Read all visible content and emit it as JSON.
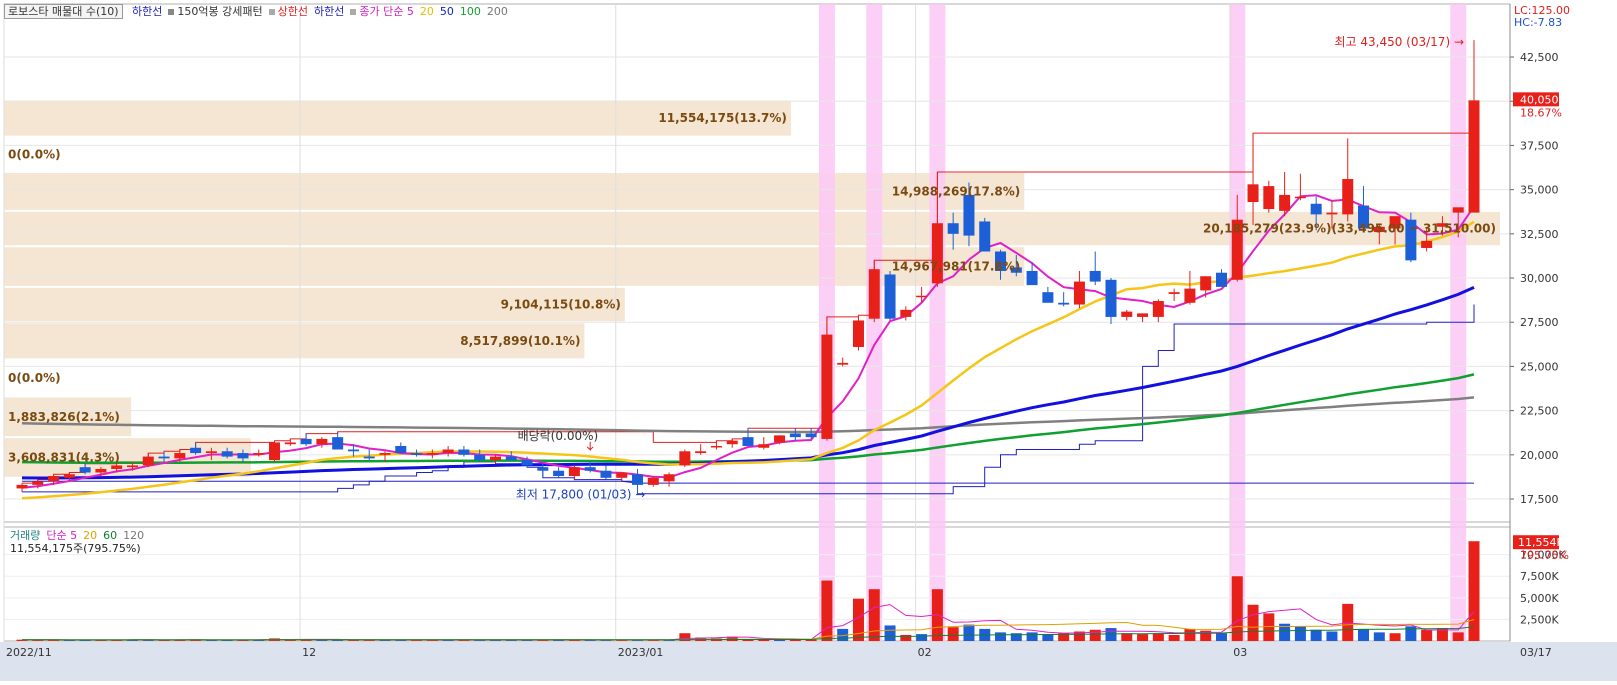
{
  "legend_top": {
    "box_label": "로보스타 매물대 수(10)",
    "items": [
      {
        "text": "하한선",
        "color": "#2020c0"
      },
      {
        "text": "150억봉 강세패턴",
        "color": "#333333",
        "square": "#888888"
      },
      {
        "text": "상한선",
        "color": "#e02020",
        "square": "#aaaaaa"
      },
      {
        "text": "하한선",
        "color": "#2020c0"
      },
      {
        "text": "종가 단순 5",
        "color": "#d020c0",
        "square": "#aaaaaa"
      },
      {
        "text": "20",
        "color": "#e0c000"
      },
      {
        "text": "50",
        "color": "#1020d0"
      },
      {
        "text": "100",
        "color": "#10a030"
      },
      {
        "text": "200",
        "color": "#777777"
      }
    ]
  },
  "legend_vol": {
    "items": [
      {
        "text": "거래량",
        "color": "#208080"
      },
      {
        "text": "단순 5",
        "color": "#d020c0"
      },
      {
        "text": "20",
        "color": "#e0a000"
      },
      {
        "text": "60",
        "color": "#108030"
      },
      {
        "text": "120",
        "color": "#777777"
      }
    ],
    "value_line": "11,554,175주(795.75%)"
  },
  "corner_labels": {
    "lc": "LC:125.00",
    "hc": "HC:-7.83"
  },
  "price_tag": {
    "value": "40,050",
    "pct": "18.67%"
  },
  "vol_tag": {
    "value": "11,554K",
    "pct": "795.75%"
  },
  "annotations": {
    "high": "최고 43,450 (03/17) →",
    "low": "최저 17,800 (01/03) →",
    "dividend": "배당락(0.00%)"
  },
  "colors": {
    "up": "#e8201a",
    "down": "#1c5fd6",
    "zone": "#f5e6d3",
    "highlight": "#fbc8f5",
    "ma5": "#e020c8",
    "ma20": "#f5c518",
    "ma50": "#1010e0",
    "ma100": "#10a030",
    "ma200": "#808080"
  },
  "chart_data": {
    "type": "candlestick",
    "price_axis": {
      "ticks": [
        17500,
        20000,
        22500,
        25000,
        27500,
        30000,
        32500,
        35000,
        37500,
        40000,
        42500
      ],
      "tick_labels": [
        "17,500",
        "20,000",
        "22,500",
        "25,000",
        "27,500",
        "30,000",
        "32,500",
        "35,000",
        "37,500",
        "40,000",
        "42,500"
      ],
      "ylim": [
        16200,
        45500
      ]
    },
    "volume_axis": {
      "ticks": [
        2500,
        5000,
        7500,
        10000
      ],
      "tick_labels": [
        "2,500K",
        "5,000K",
        "7,500K",
        "10,000K"
      ],
      "ylim": [
        0,
        13200
      ]
    },
    "x_labels": [
      {
        "label": "2022/11",
        "bar": 0
      },
      {
        "label": "12",
        "bar": 18
      },
      {
        "label": "2023/01",
        "bar": 38
      },
      {
        "label": "02",
        "bar": 57
      },
      {
        "label": "03",
        "bar": 77
      },
      {
        "label": "03/17",
        "bar": 88
      }
    ],
    "candles": [
      [
        18100,
        18400,
        17900,
        18300
      ],
      [
        18300,
        18600,
        18100,
        18500
      ],
      [
        18500,
        18900,
        18300,
        18800
      ],
      [
        18700,
        19000,
        18500,
        18900
      ],
      [
        19300,
        19500,
        18900,
        19000
      ],
      [
        19000,
        19300,
        18800,
        19200
      ],
      [
        19200,
        19600,
        19000,
        19400
      ],
      [
        19300,
        19600,
        19100,
        19400
      ],
      [
        19400,
        20100,
        19300,
        19900
      ],
      [
        19900,
        20200,
        19600,
        19800
      ],
      [
        19800,
        20300,
        19600,
        20100
      ],
      [
        20400,
        20700,
        20000,
        20100
      ],
      [
        20100,
        20400,
        19700,
        20200
      ],
      [
        20200,
        20400,
        19800,
        19900
      ],
      [
        20100,
        20300,
        19600,
        19800
      ],
      [
        20000,
        20300,
        19900,
        20100
      ],
      [
        19700,
        20800,
        19600,
        20700
      ],
      [
        20600,
        20900,
        20500,
        20700
      ],
      [
        20900,
        21200,
        20500,
        20600
      ],
      [
        20600,
        21000,
        20400,
        20900
      ],
      [
        21000,
        21300,
        20600,
        20300
      ],
      [
        20300,
        20600,
        19900,
        20200
      ],
      [
        19900,
        20300,
        19700,
        19800
      ],
      [
        20000,
        20200,
        19600,
        20100
      ],
      [
        20500,
        20700,
        20100,
        20100
      ],
      [
        20100,
        20300,
        19900,
        20000
      ],
      [
        20000,
        20300,
        19800,
        20100
      ],
      [
        20100,
        20500,
        19900,
        20300
      ],
      [
        20300,
        20500,
        19900,
        20000
      ],
      [
        20000,
        20300,
        19600,
        19700
      ],
      [
        19700,
        20000,
        19500,
        19900
      ],
      [
        19900,
        20200,
        19700,
        19700
      ],
      [
        19700,
        19900,
        19300,
        19400
      ],
      [
        19300,
        19500,
        18700,
        19100
      ],
      [
        19100,
        19300,
        18700,
        18800
      ],
      [
        18800,
        19400,
        18600,
        19300
      ],
      [
        19300,
        19600,
        19000,
        19100
      ],
      [
        19100,
        19400,
        18600,
        18700
      ],
      [
        18700,
        19000,
        18500,
        19000
      ],
      [
        18900,
        19200,
        17800,
        18300
      ],
      [
        18300,
        18800,
        18200,
        18700
      ],
      [
        18500,
        19000,
        18200,
        18900
      ],
      [
        19400,
        20300,
        19300,
        20200
      ],
      [
        20100,
        20600,
        20000,
        20200
      ],
      [
        20500,
        20800,
        20300,
        20500
      ],
      [
        20600,
        20900,
        20400,
        20800
      ],
      [
        21000,
        21500,
        20900,
        20500
      ],
      [
        20400,
        21000,
        20300,
        20600
      ],
      [
        20700,
        21100,
        20600,
        21100
      ],
      [
        21200,
        21500,
        20800,
        21000
      ],
      [
        21200,
        21500,
        20900,
        21000
      ],
      [
        20900,
        27800,
        20800,
        26800
      ],
      [
        25100,
        25500,
        25000,
        25200
      ],
      [
        26100,
        27900,
        25900,
        27600
      ],
      [
        27700,
        31000,
        27500,
        30500
      ],
      [
        30200,
        30400,
        27600,
        27700
      ],
      [
        27800,
        28400,
        27600,
        28200
      ],
      [
        29000,
        29500,
        28600,
        29000
      ],
      [
        29700,
        36000,
        29500,
        33100
      ],
      [
        33100,
        33700,
        31600,
        32500
      ],
      [
        34700,
        35400,
        31800,
        32400
      ],
      [
        33200,
        33400,
        31500,
        31500
      ],
      [
        31500,
        31600,
        29900,
        30400
      ],
      [
        30600,
        31300,
        30100,
        30300
      ],
      [
        30400,
        30900,
        29900,
        29600
      ],
      [
        29200,
        29500,
        28800,
        28600
      ],
      [
        28600,
        29200,
        28400,
        28500
      ],
      [
        28500,
        30400,
        28300,
        29800
      ],
      [
        30400,
        31500,
        29600,
        29800
      ],
      [
        29900,
        30000,
        27400,
        27800
      ],
      [
        27800,
        28200,
        27600,
        28100
      ],
      [
        27800,
        28000,
        27500,
        28000
      ],
      [
        27800,
        28800,
        27500,
        28700
      ],
      [
        29100,
        29400,
        28700,
        29200
      ],
      [
        28600,
        30400,
        28500,
        29400
      ],
      [
        29300,
        30100,
        28900,
        30100
      ],
      [
        30300,
        30500,
        29500,
        29500
      ],
      [
        29900,
        34700,
        29800,
        33300
      ],
      [
        34300,
        38200,
        33000,
        35300
      ],
      [
        33900,
        35500,
        33700,
        35200
      ],
      [
        33800,
        36000,
        33500,
        34700
      ],
      [
        34600,
        35900,
        34400,
        34600
      ],
      [
        34200,
        34600,
        32700,
        33600
      ],
      [
        33600,
        34400,
        32800,
        33700
      ],
      [
        33600,
        37900,
        33200,
        35600
      ],
      [
        34100,
        35200,
        32700,
        32800
      ],
      [
        32600,
        33000,
        31900,
        32900
      ],
      [
        32800,
        33300,
        31900,
        33500
      ],
      [
        33300,
        33700,
        30900,
        31000
      ],
      [
        31700,
        32800,
        31500,
        32100
      ],
      [
        32900,
        33500,
        32400,
        33100
      ],
      [
        33700,
        33800,
        32300,
        34000
      ],
      [
        33700,
        43450,
        36300,
        40050
      ]
    ],
    "volumes": [
      [
        150,
        "up"
      ],
      [
        120,
        "up"
      ],
      [
        150,
        "up"
      ],
      [
        110,
        "down"
      ],
      [
        130,
        "down"
      ],
      [
        120,
        "up"
      ],
      [
        150,
        "up"
      ],
      [
        140,
        "down"
      ],
      [
        130,
        "down"
      ],
      [
        120,
        "up"
      ],
      [
        130,
        "up"
      ],
      [
        160,
        "up"
      ],
      [
        120,
        "down"
      ],
      [
        130,
        "down"
      ],
      [
        120,
        "up"
      ],
      [
        140,
        "down"
      ],
      [
        300,
        "up"
      ],
      [
        180,
        "up"
      ],
      [
        160,
        "up"
      ],
      [
        150,
        "down"
      ],
      [
        130,
        "down"
      ],
      [
        150,
        "up"
      ],
      [
        110,
        "up"
      ],
      [
        120,
        "down"
      ],
      [
        150,
        "down"
      ],
      [
        130,
        "up"
      ],
      [
        140,
        "up"
      ],
      [
        120,
        "down"
      ],
      [
        130,
        "up"
      ],
      [
        120,
        "down"
      ],
      [
        150,
        "down"
      ],
      [
        110,
        "down"
      ],
      [
        130,
        "down"
      ],
      [
        150,
        "up"
      ],
      [
        130,
        "down"
      ],
      [
        120,
        "up"
      ],
      [
        130,
        "down"
      ],
      [
        120,
        "down"
      ],
      [
        140,
        "up"
      ],
      [
        150,
        "down"
      ],
      [
        120,
        "up"
      ],
      [
        130,
        "down"
      ],
      [
        900,
        "up"
      ],
      [
        400,
        "up"
      ],
      [
        300,
        "up"
      ],
      [
        500,
        "up"
      ],
      [
        180,
        "up"
      ],
      [
        150,
        "up"
      ],
      [
        200,
        "down"
      ],
      [
        180,
        "up"
      ],
      [
        150,
        "up"
      ],
      [
        7000,
        "up"
      ],
      [
        1400,
        "down"
      ],
      [
        4900,
        "up"
      ],
      [
        6000,
        "up"
      ],
      [
        1800,
        "down"
      ],
      [
        700,
        "up"
      ],
      [
        800,
        "down"
      ],
      [
        6000,
        "up"
      ],
      [
        1600,
        "up"
      ],
      [
        1900,
        "down"
      ],
      [
        1400,
        "down"
      ],
      [
        1000,
        "down"
      ],
      [
        900,
        "down"
      ],
      [
        1000,
        "down"
      ],
      [
        800,
        "down"
      ],
      [
        900,
        "up"
      ],
      [
        1100,
        "up"
      ],
      [
        1300,
        "up"
      ],
      [
        1500,
        "down"
      ],
      [
        900,
        "up"
      ],
      [
        800,
        "up"
      ],
      [
        900,
        "up"
      ],
      [
        700,
        "up"
      ],
      [
        1400,
        "up"
      ],
      [
        1200,
        "up"
      ],
      [
        900,
        "down"
      ],
      [
        7500,
        "up"
      ],
      [
        4200,
        "up"
      ],
      [
        3200,
        "up"
      ],
      [
        2000,
        "down"
      ],
      [
        1700,
        "down"
      ],
      [
        1300,
        "down"
      ],
      [
        1100,
        "down"
      ],
      [
        4300,
        "up"
      ],
      [
        1400,
        "down"
      ],
      [
        1000,
        "down"
      ],
      [
        900,
        "up"
      ],
      [
        1700,
        "down"
      ],
      [
        1300,
        "up"
      ],
      [
        1500,
        "up"
      ],
      [
        1000,
        "up"
      ],
      [
        11554,
        "up"
      ]
    ],
    "highlight_bars": [
      51,
      54,
      58,
      77,
      91
    ],
    "volume_profile": [
      {
        "low": 38000,
        "high": 40100,
        "label": "11,554,175(13.7%)",
        "frac": 0.526
      },
      {
        "low": 36000,
        "high": 38000,
        "label": "0(0.0%)",
        "frac": 0.0
      },
      {
        "low": 33800,
        "high": 36000,
        "label": "14,988,269(17.8%)",
        "frac": 0.682
      },
      {
        "low": 31800,
        "high": 33800,
        "label": "20,185,279(23.9%)(33,495.00 ~ 31,510.00)",
        "frac": 1.0
      },
      {
        "low": 29500,
        "high": 31800,
        "label": "14,967,981(17.8%)",
        "frac": 0.682
      },
      {
        "low": 27500,
        "high": 29500,
        "label": "9,104,115(10.8%)",
        "frac": 0.415
      },
      {
        "low": 25400,
        "high": 27500,
        "label": "8,517,899(10.1%)",
        "frac": 0.388
      },
      {
        "low": 23300,
        "high": 25400,
        "label": "0(0.0%)",
        "frac": 0.0
      },
      {
        "low": 21000,
        "high": 23300,
        "label": "1,883,826(2.1%)",
        "frac": 0.085
      },
      {
        "low": 18700,
        "high": 21000,
        "label": "3,608,831(4.3%)",
        "frac": 0.165
      }
    ]
  }
}
